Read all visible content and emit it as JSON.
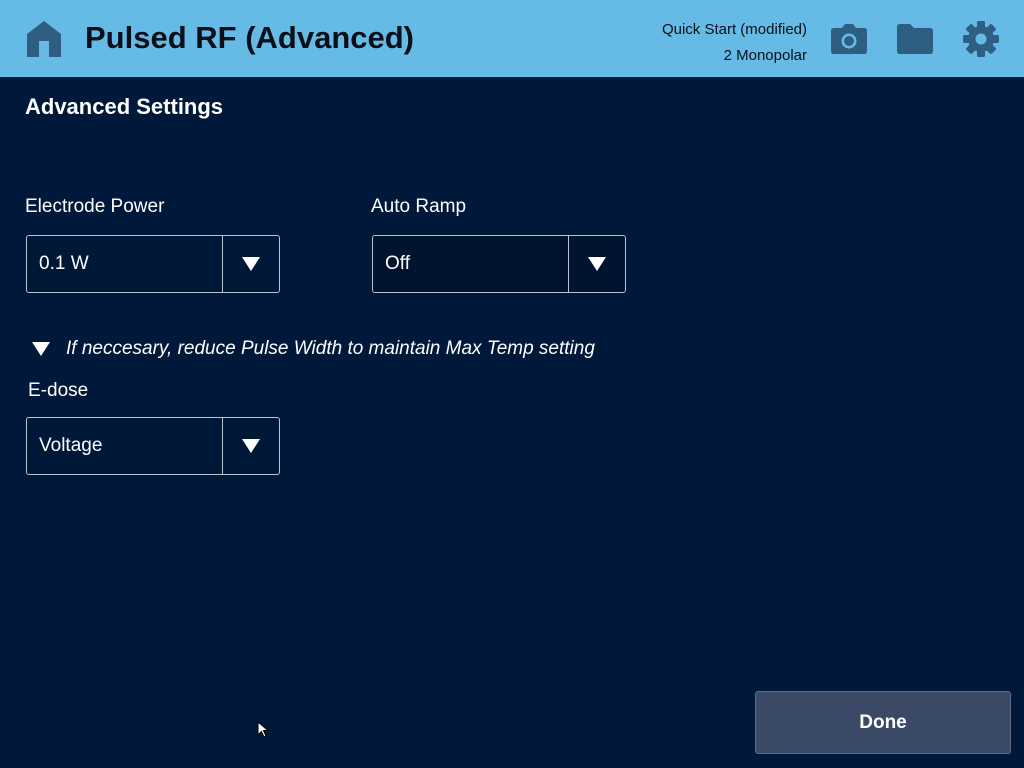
{
  "header": {
    "title": "Pulsed RF (Advanced)",
    "profile_name": "Quick Start (modified)",
    "profile_mode": "2 Monopolar",
    "icons": [
      "home-icon",
      "camera-icon",
      "folder-icon",
      "gear-icon"
    ]
  },
  "main": {
    "section_title": "Advanced Settings",
    "electrode_power": {
      "label": "Electrode Power",
      "value": "0.1 W"
    },
    "auto_ramp": {
      "label": "Auto Ramp",
      "value": "Off"
    },
    "note": "If neccesary, reduce Pulse Width to maintain Max Temp setting",
    "e_dose": {
      "label": "E-dose",
      "value": "Voltage"
    }
  },
  "footer": {
    "done_label": "Done"
  },
  "colors": {
    "header_bg": "#65bbe5",
    "page_bg": "#00183a",
    "header_icon": "#2e5f83",
    "button_bg": "#3a4a66"
  }
}
